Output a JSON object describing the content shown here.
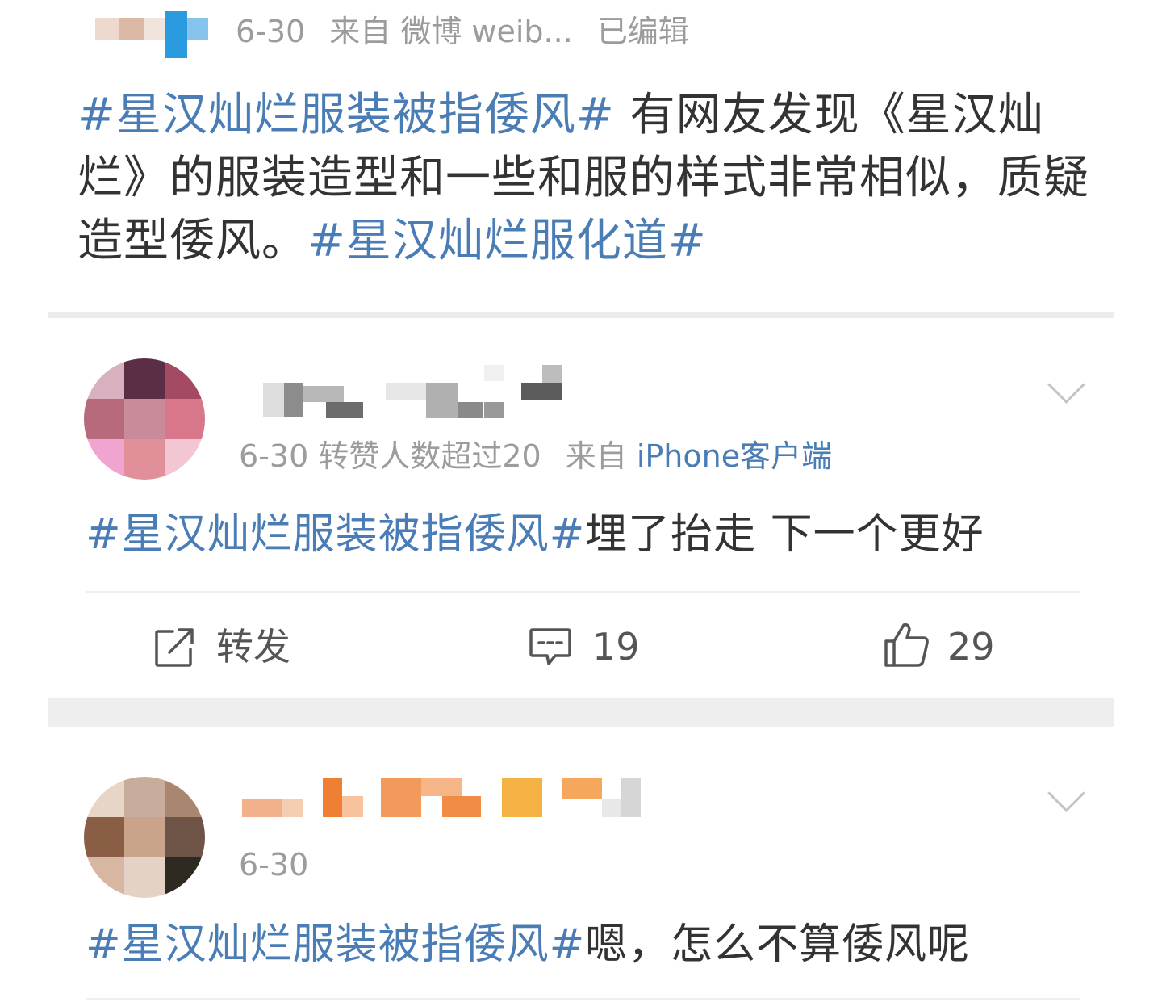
{
  "top_post": {
    "date": "6-30",
    "source": "来自 微博 weib...",
    "edited": "已编辑",
    "topic1": "#星汉灿烂服装被指倭风#",
    "body": " 有网友发现《星汉灿烂》的服装造型和一些和服的样式非常相似，质疑造型倭风。",
    "topic2": "#星汉灿烂服化道#"
  },
  "comments": [
    {
      "date": "6-30",
      "badge": "转赞人数超过20",
      "source_prefix": "来自",
      "source_client": "iPhone客户端",
      "topic": "#星汉灿烂服装被指倭风#",
      "text": "埋了抬走 下一个更好",
      "actions": {
        "repost_label": "转发",
        "comment_count": "19",
        "like_count": "29"
      },
      "icons": [
        "repost-icon",
        "comment-icon",
        "like-icon",
        "chevron-down-icon"
      ]
    },
    {
      "date": "6-30",
      "topic": "#星汉灿烂服装被指倭风#",
      "text": "嗯，怎么不算倭风呢",
      "icons": [
        "chevron-down-icon"
      ]
    }
  ],
  "colors": {
    "topic_link": "#4a7db6",
    "text": "#333333",
    "meta": "#9c9c9c",
    "separator": "#eeeeee"
  }
}
